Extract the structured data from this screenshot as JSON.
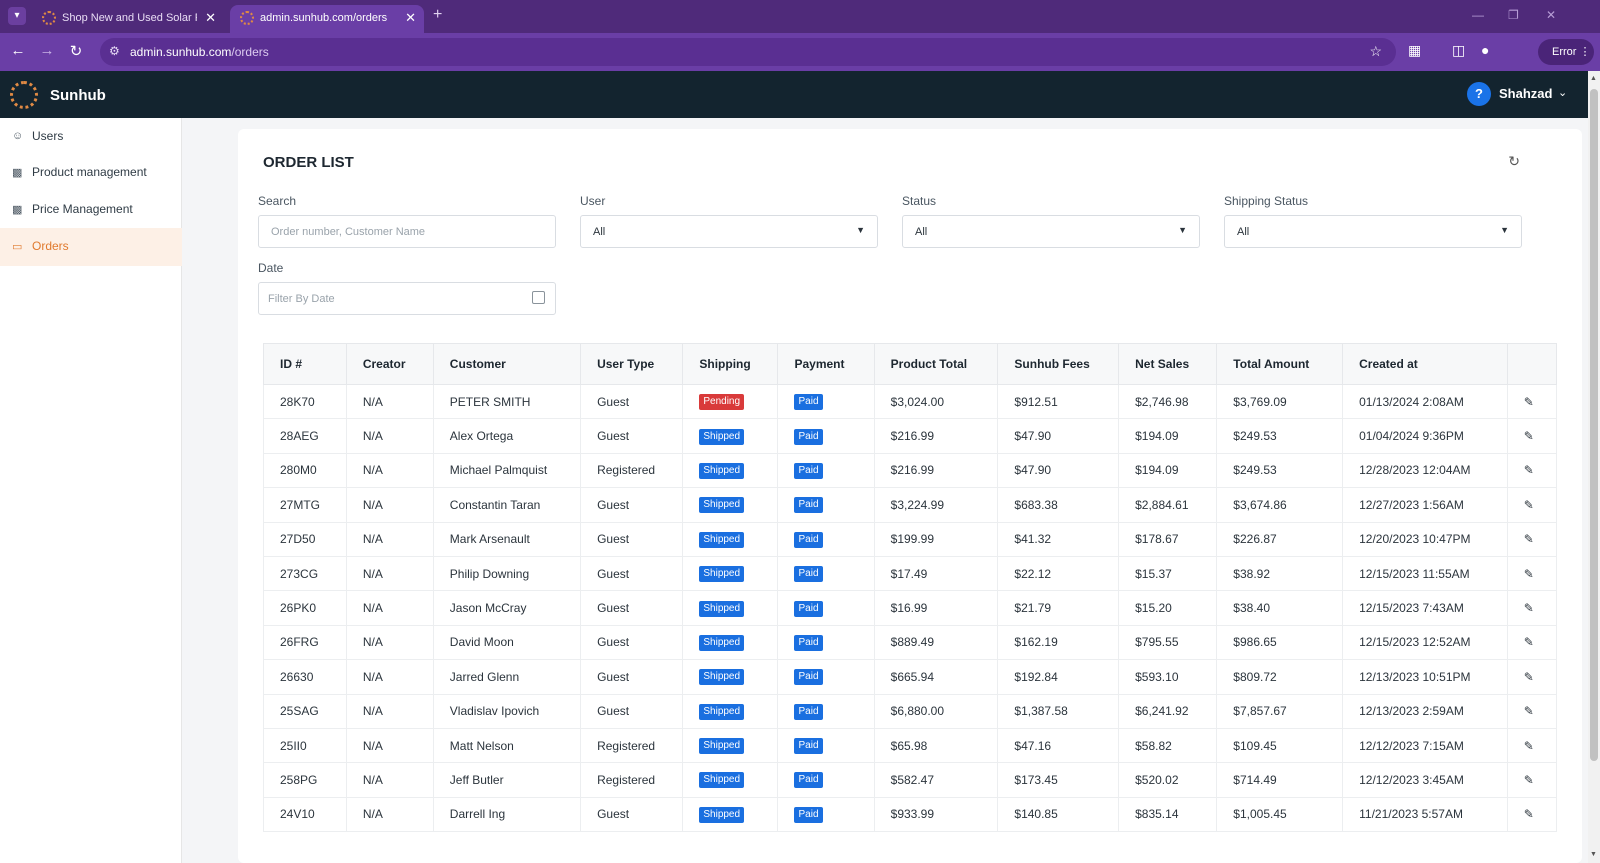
{
  "browser": {
    "tabs": [
      {
        "title": "Shop New and Used Solar Panels"
      },
      {
        "title": "admin.sunhub.com/orders"
      }
    ],
    "url_host": "admin.sunhub.com",
    "url_path": "/orders",
    "profile_status": "Error"
  },
  "app": {
    "logo_text": "Sunhub",
    "help_label": "?",
    "user_name": "Shahzad"
  },
  "sidebar": {
    "items": [
      {
        "label": "Users",
        "icon": "users-icon"
      },
      {
        "label": "Product management",
        "icon": "boxes-icon"
      },
      {
        "label": "Price Management",
        "icon": "boxes-icon"
      },
      {
        "label": "Orders",
        "icon": "clipboard-icon",
        "active": true
      }
    ]
  },
  "page": {
    "title": "ORDER LIST"
  },
  "filters": {
    "search_label": "Search",
    "search_placeholder": "Order number, Customer Name",
    "user_label": "User",
    "user_value": "All",
    "status_label": "Status",
    "status_value": "All",
    "shipping_label": "Shipping Status",
    "shipping_value": "All",
    "date_label": "Date",
    "date_placeholder": "Filter By Date"
  },
  "table": {
    "headers": [
      "ID #",
      "Creator",
      "Customer",
      "User Type",
      "Shipping",
      "Payment",
      "Product Total",
      "Sunhub Fees",
      "Net Sales",
      "Total Amount",
      "Created at",
      ""
    ],
    "rows": [
      [
        "28K70",
        "N/A",
        "PETER SMITH",
        "Guest",
        "Pending",
        "Paid",
        "$3,024.00",
        "$912.51",
        "$2,746.98",
        "$3,769.09",
        "01/13/2024 2:08AM"
      ],
      [
        "28AEG",
        "N/A",
        "Alex Ortega",
        "Guest",
        "Shipped",
        "Paid",
        "$216.99",
        "$47.90",
        "$194.09",
        "$249.53",
        "01/04/2024 9:36PM"
      ],
      [
        "280M0",
        "N/A",
        "Michael Palmquist",
        "Registered",
        "Shipped",
        "Paid",
        "$216.99",
        "$47.90",
        "$194.09",
        "$249.53",
        "12/28/2023 12:04AM"
      ],
      [
        "27MTG",
        "N/A",
        "Constantin Taran",
        "Guest",
        "Shipped",
        "Paid",
        "$3,224.99",
        "$683.38",
        "$2,884.61",
        "$3,674.86",
        "12/27/2023 1:56AM"
      ],
      [
        "27D50",
        "N/A",
        "Mark Arsenault",
        "Guest",
        "Shipped",
        "Paid",
        "$199.99",
        "$41.32",
        "$178.67",
        "$226.87",
        "12/20/2023 10:47PM"
      ],
      [
        "273CG",
        "N/A",
        "Philip Downing",
        "Guest",
        "Shipped",
        "Paid",
        "$17.49",
        "$22.12",
        "$15.37",
        "$38.92",
        "12/15/2023 11:55AM"
      ],
      [
        "26PK0",
        "N/A",
        "Jason McCray",
        "Guest",
        "Shipped",
        "Paid",
        "$16.99",
        "$21.79",
        "$15.20",
        "$38.40",
        "12/15/2023 7:43AM"
      ],
      [
        "26FRG",
        "N/A",
        "David Moon",
        "Guest",
        "Shipped",
        "Paid",
        "$889.49",
        "$162.19",
        "$795.55",
        "$986.65",
        "12/15/2023 12:52AM"
      ],
      [
        "26630",
        "N/A",
        "Jarred Glenn",
        "Guest",
        "Shipped",
        "Paid",
        "$665.94",
        "$192.84",
        "$593.10",
        "$809.72",
        "12/13/2023 10:51PM"
      ],
      [
        "25SAG",
        "N/A",
        "Vladislav Ipovich",
        "Guest",
        "Shipped",
        "Paid",
        "$6,880.00",
        "$1,387.58",
        "$6,241.92",
        "$7,857.67",
        "12/13/2023 2:59AM"
      ],
      [
        "25II0",
        "N/A",
        "Matt Nelson",
        "Registered",
        "Shipped",
        "Paid",
        "$65.98",
        "$47.16",
        "$58.82",
        "$109.45",
        "12/12/2023 7:15AM"
      ],
      [
        "258PG",
        "N/A",
        "Jeff Butler",
        "Registered",
        "Shipped",
        "Paid",
        "$582.47",
        "$173.45",
        "$520.02",
        "$714.49",
        "12/12/2023 3:45AM"
      ],
      [
        "24V10",
        "N/A",
        "Darrell Ing",
        "Guest",
        "Shipped",
        "Paid",
        "$933.99",
        "$140.85",
        "$835.14",
        "$1,005.45",
        "11/21/2023 5:57AM"
      ]
    ]
  },
  "colors": {
    "chrome_purple": "#6a3ea6",
    "header_dark": "#13242f",
    "accent_orange": "#e07a2e",
    "badge_blue": "#1a6fe0",
    "badge_red": "#d93a3a"
  }
}
